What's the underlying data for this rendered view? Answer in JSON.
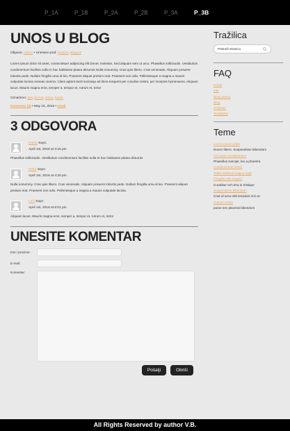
{
  "nav": [
    "P_1A",
    "P_1B",
    "P_2A",
    "P_2B",
    "P_3A",
    "P_3B"
  ],
  "nav_active": "P_3B",
  "post": {
    "title": "UNOS U BLOG",
    "meta_prefix": "Objavio:",
    "author": "Admin",
    "meta_mid": "• Unesano pod:",
    "cat1": "Naslovi",
    "cat_sep": ",",
    "cat2": "Blogovi",
    "body": "Lorem ipsum dolor sit amet, consectetuer adipiscing elit Donec molestie, Sed aliquam sem ut arcu. Phasellus sollicitudin. Vestibulum condimentum facilisis nulla In hac habitasse platea dictumst Nulla nonummy. Cras quis libero. Cras venenatis. Aliquam posuere lobortis pede. Nullam fringilla urna id leo. Praesent aliquet pretium erat. Praesent non odio. Pellentesque a magna a mauris vulputate lacinia Aenean viverra. Class aptent taciti sociosqu ad litora torquent per conubia nostra, per inceptos hymenaeos. Aliquam lacus. Mauris magna eros, semper a, tempor et, rutrum et, tortor",
    "tags_prefix": "Označeno:",
    "tags": [
      "ipsi",
      "lectus",
      "netus",
      "lorem"
    ],
    "comments_link": "Komentar (3)",
    "date": "• May 15, 2015 •",
    "edit": "Uredi"
  },
  "responses": {
    "title": "3 ODGOVORA",
    "says": "Says:",
    "items": [
      {
        "name": "Darko",
        "date": "April 1st, 2016 at 3:15 pm",
        "text": "Phasellus sollicitudin. Vestibulum condimentum facilisis nulla In hac habitasse platea dictumst"
      },
      {
        "name": "Petro",
        "date": "April 1st, 2016 at 4:20 pm",
        "text": "Nulla nonummy. Cras quis libero. Cras venenatis. Aliquam posuere lobortis pede. Nullam fringilla urna id leo. Praesent aliquet pretium erat. Praesent non odio. Pellentesque a magna a mauris vulputate lacinia."
      },
      {
        "name": "Luči",
        "date": "April 1st, 2016 at 5:01 pm",
        "text": "Aliquam lacus. Mauris magna eros, semper a, tempor et, rutrum et, tortor"
      }
    ]
  },
  "form": {
    "title": "UNESITE KOMENTAR",
    "name_label": "Ime i prezime:",
    "email_label": "E-mail:",
    "comment_label": "Komentar:",
    "submit": "Pošalji",
    "clear": "Obriši"
  },
  "sidebar": {
    "search_title": "Tražilica",
    "search_placeholder": "Pretraži stranicu",
    "faq_title": "FAQ",
    "faq_links": [
      "Home",
      "Info",
      "Shop Demo",
      "Blog",
      "Archives",
      "Templates"
    ],
    "teme_title": "Teme",
    "teme": [
      {
        "t": "Lorem ipsum dolor",
        "link": true
      },
      {
        "t": "Donec libero. Suspendisse bibendum",
        "link": false
      },
      {
        "t": "Cid amet condimentum",
        "link": true
      },
      {
        "t": "Phasellus suscipit, leo a pharetra",
        "link": false
      },
      {
        "t": "Condimentum lorem",
        "link": true
      },
      {
        "t": "Tellus eleifend magna eget",
        "link": true
      },
      {
        "t": "Fringilla velit magna",
        "link": true
      },
      {
        "t": "Curabitur vel urna in tristique",
        "link": false
      },
      {
        "t": "Suspendisse bibendum",
        "link": true
      },
      {
        "t": "Cras id urna orbi tincidunt orci ac",
        "link": false
      },
      {
        "t": "Cursus mattis",
        "link": true
      },
      {
        "t": "purus nec placerat bibendum",
        "link": false
      }
    ]
  },
  "footer": "All Rights Reserved by author V.B."
}
